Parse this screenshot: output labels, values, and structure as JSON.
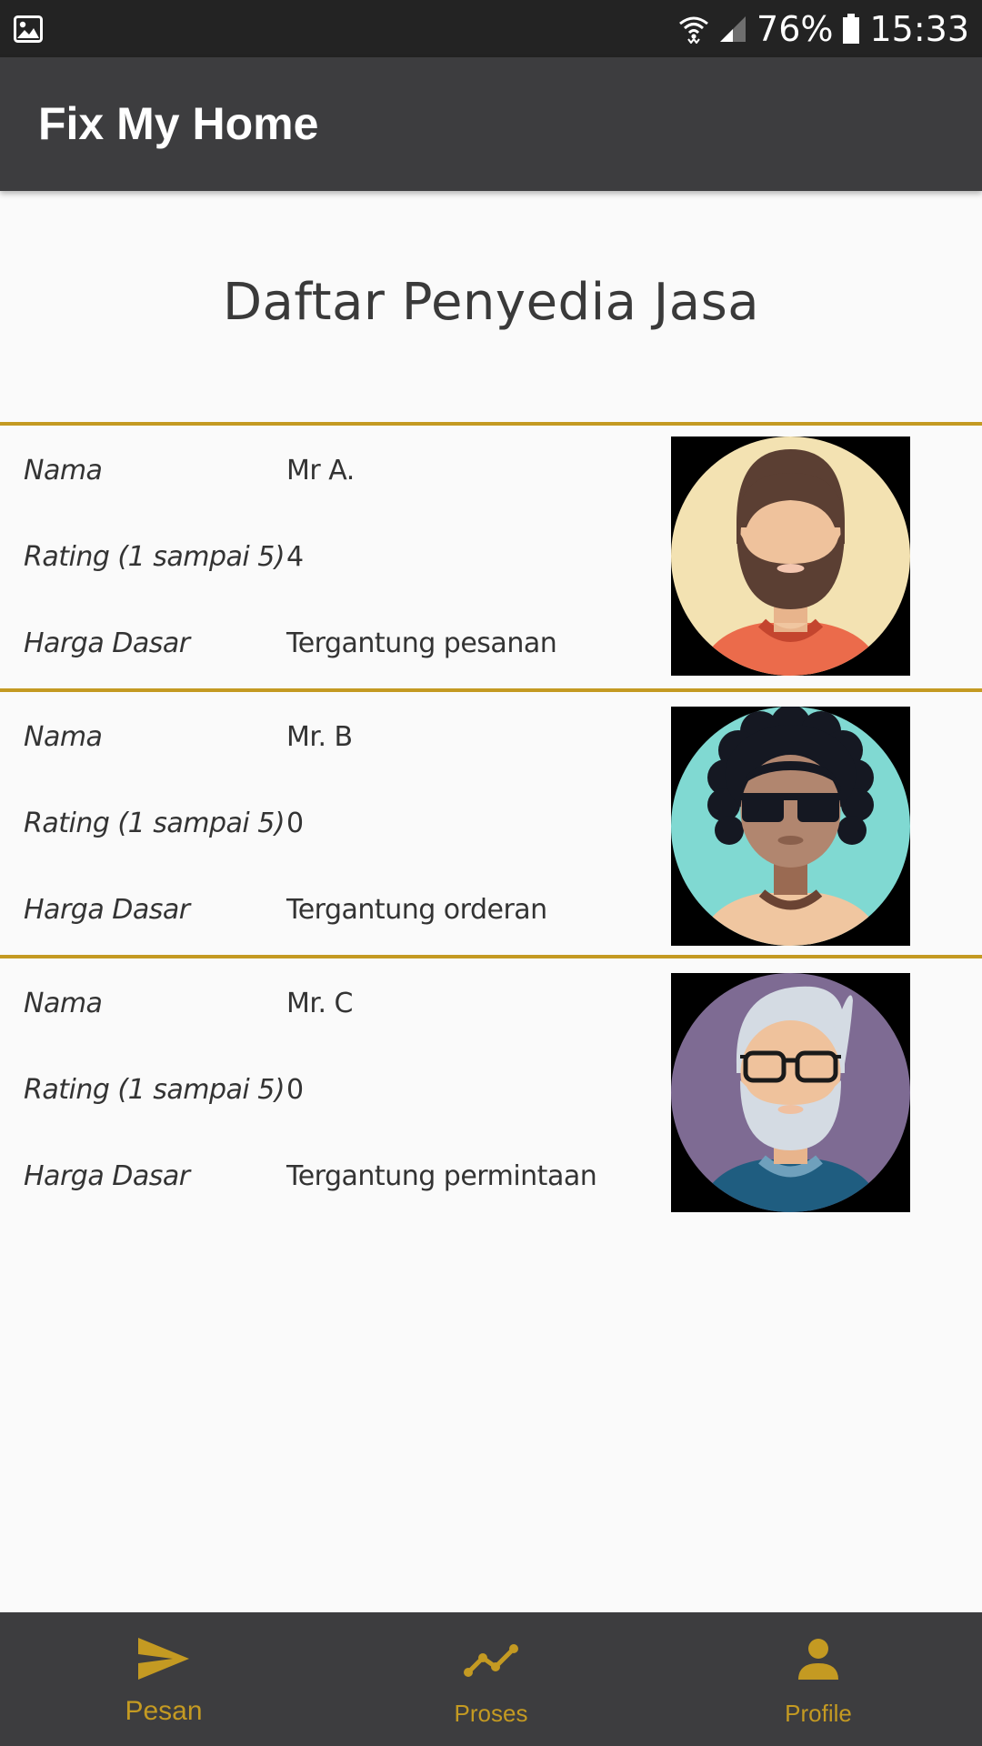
{
  "status_bar": {
    "icons": [
      "image-icon",
      "wifi-icon",
      "signal-icon",
      "battery-icon"
    ],
    "battery": "76%",
    "time": "15:33"
  },
  "app_bar": {
    "title": "Fix My Home"
  },
  "page": {
    "heading": "Daftar Penyedia Jasa"
  },
  "accent_color": "#c49a22",
  "labels": {
    "name": "Nama",
    "rating": "Rating (1 sampai 5)",
    "price": "Harga Dasar"
  },
  "providers": [
    {
      "name": "Mr A.",
      "rating": "4",
      "price": "Tergantung pesanan",
      "avatar_icon": "bearded-man-avatar-icon"
    },
    {
      "name": "Mr. B",
      "rating": "0",
      "price": "Tergantung orderan",
      "avatar_icon": "curly-hair-sunglasses-avatar-icon"
    },
    {
      "name": "Mr. C",
      "rating": "0",
      "price": "Tergantung permintaan",
      "avatar_icon": "old-man-glasses-avatar-icon"
    }
  ],
  "bottom_nav": {
    "items": [
      {
        "label": "Pesan",
        "icon": "send-icon",
        "active": true
      },
      {
        "label": "Proses",
        "icon": "trend-icon",
        "active": false
      },
      {
        "label": "Profile",
        "icon": "person-icon",
        "active": false
      }
    ]
  }
}
